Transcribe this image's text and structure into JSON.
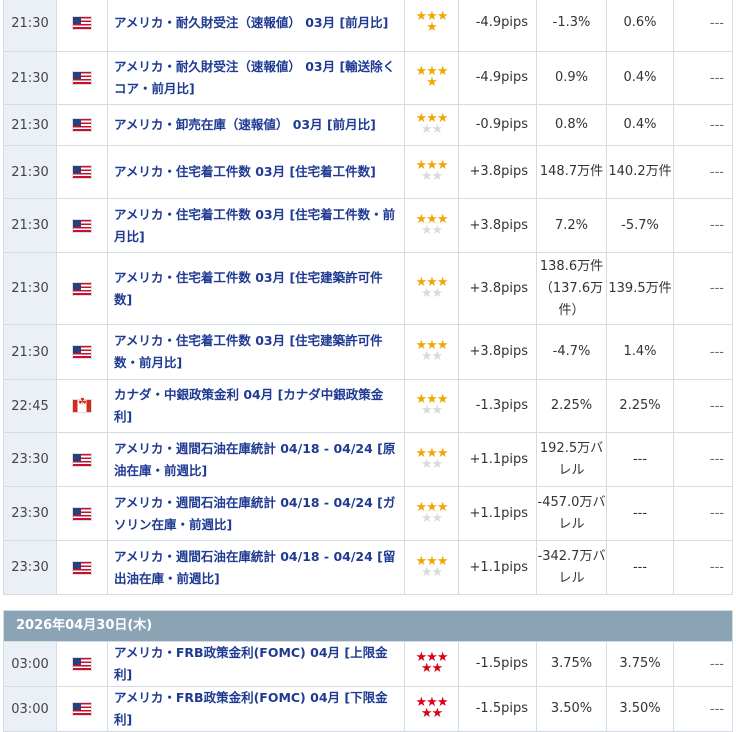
{
  "rows_before": [
    {
      "time": "21:30",
      "flag": "us",
      "name": "アメリカ・耐久財受注（速報値） 03月 [前月比]",
      "importance": "3-gold-1-gold",
      "pips": "-4.9pips",
      "forecast": "-1.3%",
      "previous": "0.6%",
      "actual": "---"
    },
    {
      "time": "21:30",
      "flag": "us",
      "name": "アメリカ・耐久財受注（速報値） 03月 [輸送除くコア・前月比]",
      "importance": "3-gold-1-gold",
      "pips": "-4.9pips",
      "forecast": "0.9%",
      "previous": "0.4%",
      "actual": "---"
    },
    {
      "time": "21:30",
      "flag": "us",
      "name": "アメリカ・卸売在庫（速報値） 03月 [前月比]",
      "importance": "3-gold-2-grey",
      "pips": "-0.9pips",
      "forecast": "0.8%",
      "previous": "0.4%",
      "actual": "---"
    },
    {
      "time": "21:30",
      "flag": "us",
      "name": "アメリカ・住宅着工件数 03月 [住宅着工件数]",
      "importance": "3-gold-2-grey",
      "pips": "+3.8pips",
      "forecast": "148.7万件",
      "previous": "140.2万件",
      "actual": "---"
    },
    {
      "time": "21:30",
      "flag": "us",
      "name": "アメリカ・住宅着工件数 03月 [住宅着工件数・前月比]",
      "importance": "3-gold-2-grey",
      "pips": "+3.8pips",
      "forecast": "7.2%",
      "previous": "-5.7%",
      "actual": "---"
    },
    {
      "time": "21:30",
      "flag": "us",
      "name": "アメリカ・住宅着工件数 03月 [住宅建築許可件数]",
      "importance": "3-gold-2-grey",
      "pips": "+3.8pips",
      "forecast": "138.6万件（137.6万件）",
      "previous": "139.5万件",
      "actual": "---"
    },
    {
      "time": "21:30",
      "flag": "us",
      "name": "アメリカ・住宅着工件数 03月 [住宅建築許可件数・前月比]",
      "importance": "3-gold-2-grey",
      "pips": "+3.8pips",
      "forecast": "-4.7%",
      "previous": "1.4%",
      "actual": "---"
    },
    {
      "time": "22:45",
      "flag": "ca",
      "name": "カナダ・中銀政策金利 04月 [カナダ中銀政策金利]",
      "importance": "3-gold-2-grey",
      "pips": "-1.3pips",
      "forecast": "2.25%",
      "previous": "2.25%",
      "actual": "---"
    },
    {
      "time": "23:30",
      "flag": "us",
      "name": "アメリカ・週間石油在庫統計 04/18 - 04/24 [原油在庫・前週比]",
      "importance": "3-gold-2-grey",
      "pips": "+1.1pips",
      "forecast": "192.5万バレル",
      "previous": "---",
      "actual": "---"
    },
    {
      "time": "23:30",
      "flag": "us",
      "name": "アメリカ・週間石油在庫統計 04/18 - 04/24 [ガソリン在庫・前週比]",
      "importance": "3-gold-2-grey",
      "pips": "+1.1pips",
      "forecast": "-457.0万バレル",
      "previous": "---",
      "actual": "---"
    },
    {
      "time": "23:30",
      "flag": "us",
      "name": "アメリカ・週間石油在庫統計 04/18 - 04/24 [留出油在庫・前週比]",
      "importance": "3-gold-2-grey",
      "pips": "+1.1pips",
      "forecast": "-342.7万バレル",
      "previous": "---",
      "actual": "---"
    }
  ],
  "date_header": "2026年04月30日(木)",
  "rows_after": [
    {
      "time": "03:00",
      "flag": "us",
      "name": "アメリカ・FRB政策金利(FOMC) 04月 [上限金利]",
      "importance": "3-red-2-red",
      "pips": "-1.5pips",
      "forecast": "3.75%",
      "previous": "3.75%",
      "actual": "---"
    },
    {
      "time": "03:00",
      "flag": "us",
      "name": "アメリカ・FRB政策金利(FOMC) 04月 [下限金利]",
      "importance": "3-red-2-red",
      "pips": "-1.5pips",
      "forecast": "3.50%",
      "previous": "3.50%",
      "actual": "---"
    }
  ],
  "icons": {
    "us": "us-flag-icon",
    "ca": "canada-flag-icon",
    "star": "star-icon"
  },
  "colors": {
    "time_bg": "#eaf0f6",
    "link": "#1f3a93",
    "star_gold": "#f0a800",
    "star_red": "#d9001b",
    "star_grey": "#d6dbe0",
    "date_bar": "#8aa4b6"
  }
}
